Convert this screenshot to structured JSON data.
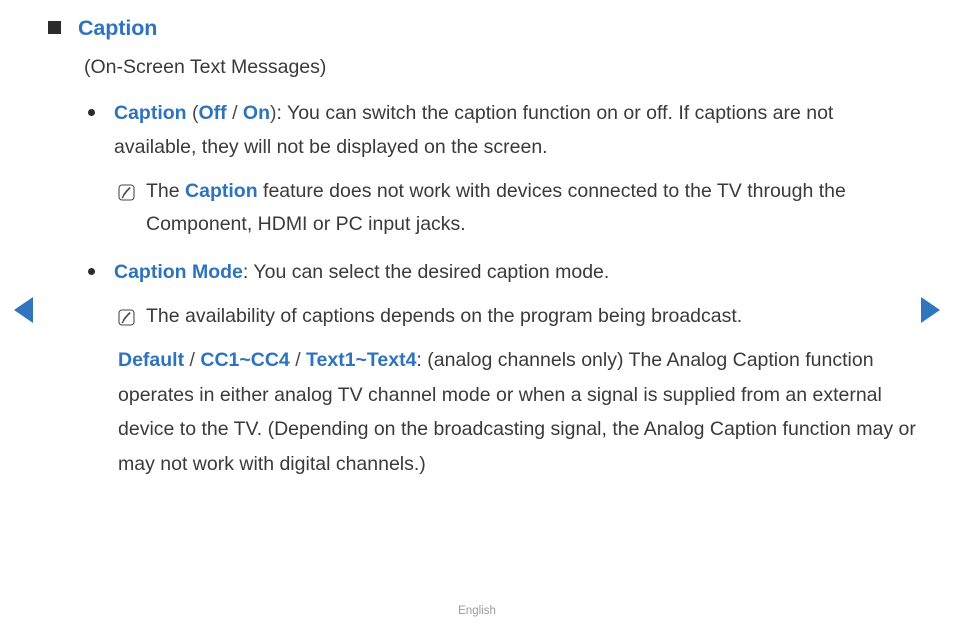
{
  "page": {
    "language_footer": "English",
    "accent_color": "#2e74bd",
    "text_color": "#3a3a3a"
  },
  "nav": {
    "prev_label": "◀",
    "next_label": "▶"
  },
  "heading": {
    "title": "Caption",
    "subtitle": "(On-Screen Text Messages)"
  },
  "bullets": [
    {
      "term": "Caption",
      "open_paren": " (",
      "option1": "Off",
      "slash": " / ",
      "option2": "On",
      "close_paren": ")",
      "colon": ": ",
      "body": "You can switch the caption function on or off. If captions are not available, they will not be displayed on the screen."
    },
    {
      "term": "Caption Mode",
      "colon": ": ",
      "body": "You can select the desired caption mode."
    }
  ],
  "notes": [
    {
      "icon": "note-pen-icon",
      "pre": "The ",
      "term": "Caption",
      "post": " feature does not work with devices connected to the TV through the Component, HDMI or PC input jacks."
    },
    {
      "icon": "note-pen-icon",
      "pre": "",
      "term": "",
      "post": "The availability of captions depends on the program being broadcast."
    }
  ],
  "paragraph": {
    "opt1": "Default",
    "sep1": " / ",
    "opt2": "CC1~CC4",
    "sep2": " / ",
    "opt3": "Text1~Text4",
    "colon": ": ",
    "body": "(analog channels only) The Analog Caption function operates in either analog TV channel mode or when a signal is supplied from an external device to the TV. (Depending on the broadcasting signal, the Analog Caption function may or may not work with digital channels.)"
  }
}
